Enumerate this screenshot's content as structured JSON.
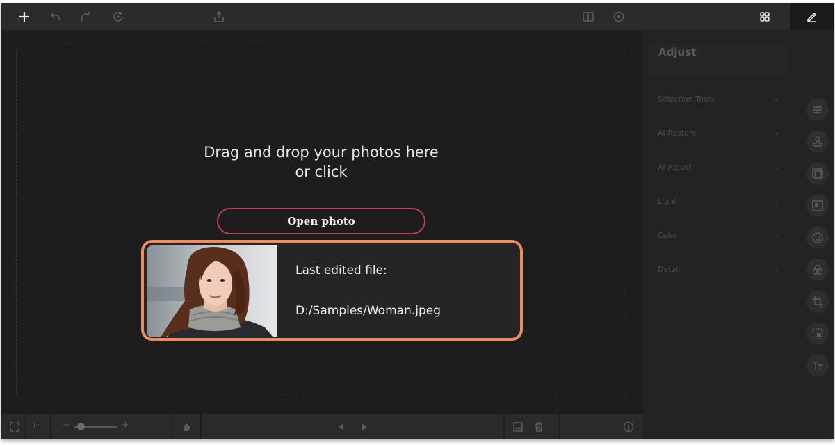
{
  "toolbar": {
    "left_icons": [
      "add-icon",
      "undo-icon",
      "redo-icon",
      "reset-icon",
      "export-icon"
    ],
    "right_icons": [
      "compare-icon",
      "preview-icon",
      "grid-view-icon",
      "edit-icon"
    ]
  },
  "canvas": {
    "drop_text_line1": "Drag and drop your photos here",
    "drop_text_line2": "or click",
    "open_button": "Open photo",
    "last_file": {
      "label": "Last edited file:",
      "path": "D:/Samples/Woman.jpeg"
    }
  },
  "bottombar": {
    "zoom_ratio": "1:1",
    "zoom_minus": "−",
    "zoom_plus": "+",
    "zoom_level": 0.1
  },
  "panel": {
    "title": "Adjust",
    "sections": [
      {
        "label": "Selection Tools"
      },
      {
        "label": "AI Restore"
      },
      {
        "label": "AI Adjust"
      },
      {
        "label": "Light"
      },
      {
        "label": "Color"
      },
      {
        "label": "Detail"
      }
    ],
    "rail_icons": [
      "adjust-sliders-icon",
      "stamp-icon",
      "image-icon",
      "layers-icon",
      "face-icon",
      "filters-icon",
      "crop-icon",
      "resize-icon",
      "text-icon"
    ]
  },
  "colors": {
    "accent_button_border": "#c1404f",
    "card_border": "#f08a60",
    "background": "#1d1d1d"
  }
}
